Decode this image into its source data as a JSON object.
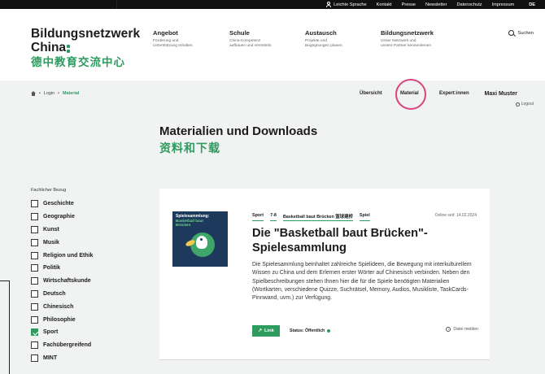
{
  "topbar": {
    "links": [
      "Leichte Sprache",
      "Kontakt",
      "Presse",
      "Newsletter",
      "Datenschutz",
      "Impressum"
    ],
    "lang": "DE"
  },
  "logo": {
    "line1": "Bildungsnetzwerk",
    "line2": "China",
    "line3": "德中教育交流中心"
  },
  "nav": [
    {
      "title": "Angebot",
      "sub1": "Förderung und",
      "sub2": "Unterstützung erhalten"
    },
    {
      "title": "Schule",
      "sub1": "China-Kompetenz",
      "sub2": "aufbauen und vermitteln"
    },
    {
      "title": "Austausch",
      "sub1": "Projekte und",
      "sub2": "Begegnungen planen"
    },
    {
      "title": "Bildungsnetzwerk",
      "sub1": "Unser Netzwerk und",
      "sub2": "unsere Partner kennenlernen"
    }
  ],
  "search_label": "Suchen",
  "breadcrumb": {
    "login": "Login",
    "current": "Material"
  },
  "subtabs": {
    "overview": "Übersicht",
    "material": "Material",
    "experts": "Expert:innen"
  },
  "user": {
    "name": "Maxi Muster",
    "logout": "Logout"
  },
  "page": {
    "title": "Materialien und Downloads",
    "title_cn": "资料和下载"
  },
  "filter": {
    "heading": "Fachlicher Bezug",
    "items": [
      {
        "label": "Geschichte",
        "checked": false
      },
      {
        "label": "Geographie",
        "checked": false
      },
      {
        "label": "Kunst",
        "checked": false
      },
      {
        "label": "Musik",
        "checked": false
      },
      {
        "label": "Religion und Ethik",
        "checked": false
      },
      {
        "label": "Politik",
        "checked": false
      },
      {
        "label": "Wirtschaftskunde",
        "checked": false
      },
      {
        "label": "Deutsch",
        "checked": false
      },
      {
        "label": "Chinesisch",
        "checked": false
      },
      {
        "label": "Philosophie",
        "checked": false
      },
      {
        "label": "Sport",
        "checked": true
      },
      {
        "label": "Fachübergreifend",
        "checked": false
      },
      {
        "label": "MINT",
        "checked": false
      }
    ]
  },
  "card": {
    "thumb_title": "Spielesammlung:",
    "thumb_sub1": "Basketball baut",
    "thumb_sub2": "Brücken",
    "tags": [
      "Sport",
      "7-8",
      "Basketball baut Brücken 篮球建桥",
      "Spiel"
    ],
    "online": "Online seit: 14.02.2024",
    "title": "Die \"Basketball baut Brücken\"-Spielesammlung",
    "description": "Die Spielesammlung beinhaltet zahlreiche Spielideen, die Bewegung mit interkulturellem Wissen zu China und dem Erlernen erster Wörter auf Chinesisch verbinden. Neben den Spielbeschreibungen stehen Ihnen hier die für die Spiele benötigten Materialien (Wortkarten, verschiedene Quizze, Suchrätsel, Memory, Audios, Musikliste, TaskCards-Pinnwand, uvm.) zur Verfügung.",
    "link_label": "Link",
    "status": "Status: Öffentlich",
    "report": "Datei melden"
  },
  "colors": {
    "accent": "#2e9b5f",
    "highlight_circle": "#d9457e",
    "thumb_bg": "#1d3a5c"
  }
}
